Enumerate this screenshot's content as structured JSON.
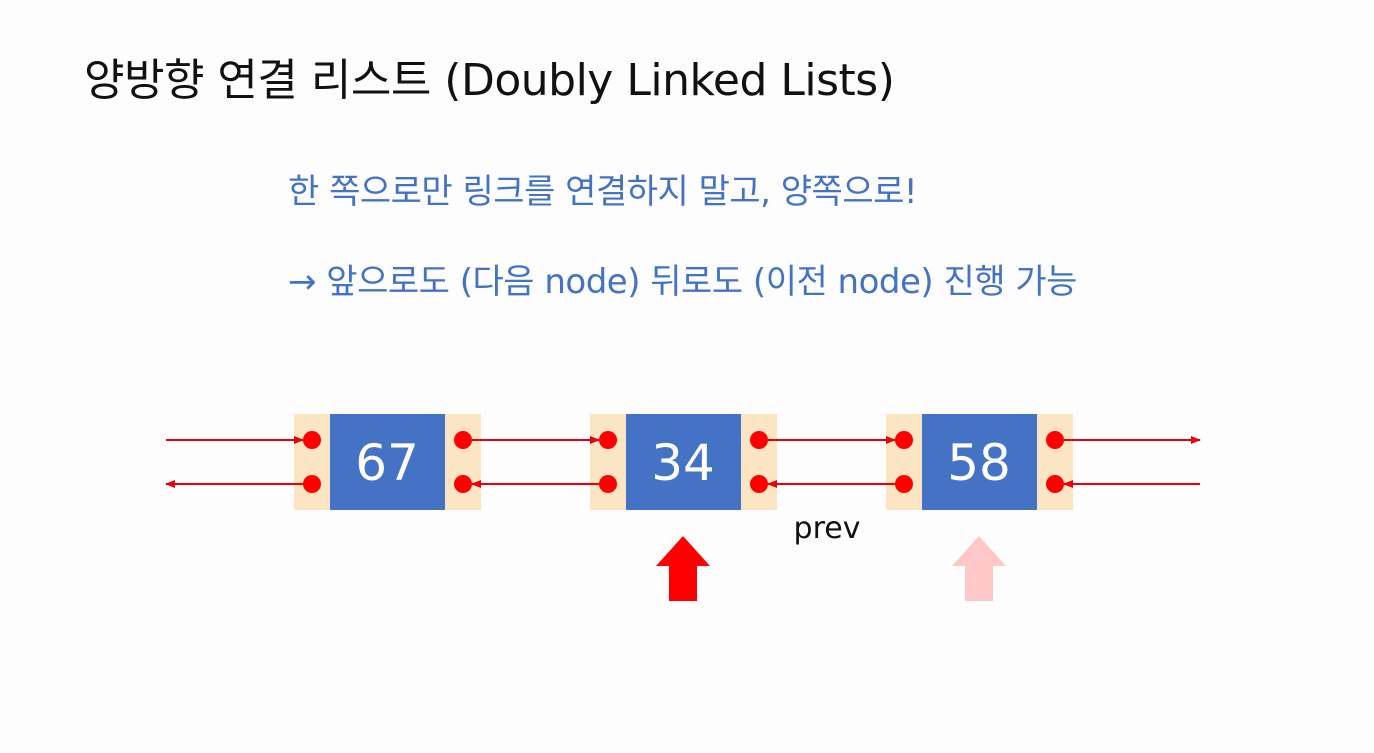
{
  "slide": {
    "title": "양방향 연결 리스트 (Doubly Linked Lists)",
    "bullet_1": "한 쪽으로만 링크를 연결하지 말고, 양쪽으로!",
    "bullet_2": "→ 앞으로도 (다음 node) 뒤로도 (이전 node) 진행 가능"
  },
  "diagram": {
    "nodes": [
      {
        "value": "67"
      },
      {
        "value": "34"
      },
      {
        "value": "58"
      }
    ],
    "pointer_label": "prev",
    "colors": {
      "node_fill": "#4472c4",
      "link_pad": "#fbe5c3",
      "link_dot": "#ff0000",
      "link_arrow": "#e8000b",
      "current_arrow": "#ff0000",
      "prev_arrow": "#ffc8c8"
    }
  }
}
